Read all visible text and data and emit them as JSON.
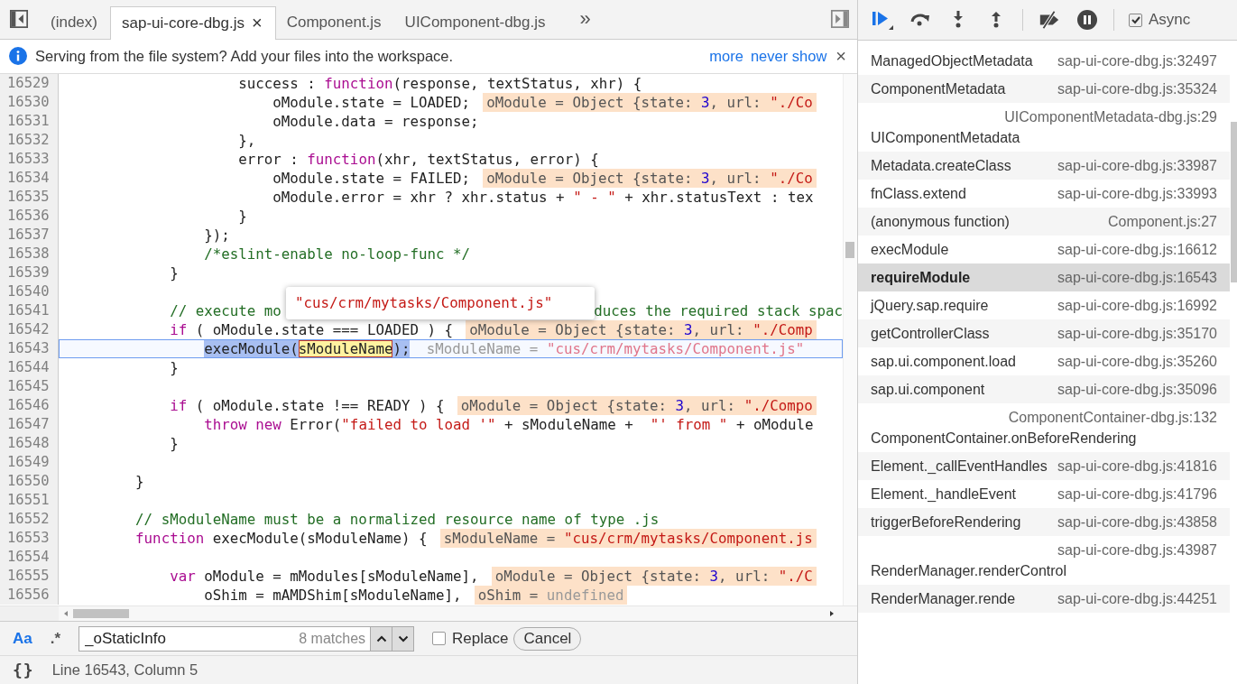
{
  "editor_tabs": {
    "tabs": [
      {
        "label": "(index)",
        "selected": false
      },
      {
        "label": "sap-ui-core-dbg.js",
        "selected": true,
        "close": "×"
      },
      {
        "label": "Component.js",
        "selected": false
      },
      {
        "label": "UIComponent-dbg.js",
        "selected": false
      }
    ],
    "more": "»"
  },
  "infobar": {
    "message": "Serving from the file system? Add your files into the workspace.",
    "links": [
      "more",
      "never show"
    ],
    "close": "×"
  },
  "code": {
    "popover": "\"cus/crm/mytasks/Component.js\"",
    "lines": [
      {
        "number": "16529",
        "current": false,
        "tokens": [
          {
            "kind": "plain",
            "text": "                    success : "
          },
          {
            "kind": "keyword",
            "text": "function"
          },
          {
            "kind": "plain",
            "text": "(response, textStatus, xhr) {"
          }
        ]
      },
      {
        "number": "16530",
        "current": false,
        "tokens": [
          {
            "kind": "plain",
            "text": "                        oModule.state = LOADED;"
          }
        ],
        "value": [
          {
            "kind": "name",
            "text": "oModule = Object {state: "
          },
          {
            "kind": "number",
            "text": "3"
          },
          {
            "kind": "name",
            "text": ", url: "
          },
          {
            "kind": "string",
            "text": "\"./Co"
          }
        ]
      },
      {
        "number": "16531",
        "current": false,
        "tokens": [
          {
            "kind": "plain",
            "text": "                        oModule.data = response;"
          }
        ]
      },
      {
        "number": "16532",
        "current": false,
        "tokens": [
          {
            "kind": "plain",
            "text": "                    },"
          }
        ]
      },
      {
        "number": "16533",
        "current": false,
        "tokens": [
          {
            "kind": "plain",
            "text": "                    error : "
          },
          {
            "kind": "keyword",
            "text": "function"
          },
          {
            "kind": "plain",
            "text": "(xhr, textStatus, error) {"
          }
        ]
      },
      {
        "number": "16534",
        "current": false,
        "tokens": [
          {
            "kind": "plain",
            "text": "                        oModule.state = FAILED;"
          }
        ],
        "value": [
          {
            "kind": "name",
            "text": "oModule = Object {state: "
          },
          {
            "kind": "number",
            "text": "3"
          },
          {
            "kind": "name",
            "text": ", url: "
          },
          {
            "kind": "string",
            "text": "\"./Co"
          }
        ]
      },
      {
        "number": "16535",
        "current": false,
        "tokens": [
          {
            "kind": "plain",
            "text": "                        oModule.error = xhr ? xhr.status + "
          },
          {
            "kind": "string",
            "text": "\" - \""
          },
          {
            "kind": "plain",
            "text": " + xhr.statusText : tex"
          }
        ]
      },
      {
        "number": "16536",
        "current": false,
        "tokens": [
          {
            "kind": "plain",
            "text": "                    }"
          }
        ]
      },
      {
        "number": "16537",
        "current": false,
        "tokens": [
          {
            "kind": "plain",
            "text": "                });"
          }
        ]
      },
      {
        "number": "16538",
        "current": false,
        "tokens": [
          {
            "kind": "comment",
            "text": "                /*eslint-enable no-loop-func */"
          }
        ]
      },
      {
        "number": "16539",
        "current": false,
        "tokens": [
          {
            "kind": "plain",
            "text": "            }"
          }
        ]
      },
      {
        "number": "16540",
        "current": false
      },
      {
        "number": "16541",
        "current": false,
        "tokens": [
          {
            "kind": "comment",
            "text": "            // execute mo"
          },
          {
            "kind": "gap"
          },
          {
            "kind": "comment",
            "text": "duces the required stack spac"
          }
        ]
      },
      {
        "number": "16542",
        "current": false,
        "tokens": [
          {
            "kind": "keyword",
            "text": "            if"
          },
          {
            "kind": "plain",
            "text": " ( oModule.state === LOADED ) {"
          }
        ],
        "value": [
          {
            "kind": "name",
            "text": "oModule = Object {state: "
          },
          {
            "kind": "number",
            "text": "3"
          },
          {
            "kind": "name",
            "text": ", url: "
          },
          {
            "kind": "string",
            "text": "\"./Comp"
          }
        ]
      },
      {
        "number": "16543",
        "current": true,
        "tokens": [
          {
            "kind": "selection",
            "text": "                execModule("
          },
          {
            "kind": "match",
            "text": "sModuleName"
          },
          {
            "kind": "selection",
            "text": ");"
          }
        ],
        "value": [
          {
            "kind": "name",
            "text": "sModuleName = "
          },
          {
            "kind": "string",
            "text": "\"cus/crm/mytasks/Component.js\""
          }
        ]
      },
      {
        "number": "16544",
        "current": false,
        "tokens": [
          {
            "kind": "plain",
            "text": "            }"
          }
        ]
      },
      {
        "number": "16545",
        "current": false
      },
      {
        "number": "16546",
        "current": false,
        "tokens": [
          {
            "kind": "keyword",
            "text": "            if"
          },
          {
            "kind": "plain",
            "text": " ( oModule.state !== READY ) {"
          }
        ],
        "value": [
          {
            "kind": "name",
            "text": "oModule = Object {state: "
          },
          {
            "kind": "number",
            "text": "3"
          },
          {
            "kind": "name",
            "text": ", url: "
          },
          {
            "kind": "string",
            "text": "\"./Compo"
          }
        ]
      },
      {
        "number": "16547",
        "current": false,
        "tokens": [
          {
            "kind": "keyword",
            "text": "                throw new"
          },
          {
            "kind": "plain",
            "text": " Error("
          },
          {
            "kind": "string",
            "text": "\"failed to load '\""
          },
          {
            "kind": "plain",
            "text": " + sModuleName +  "
          },
          {
            "kind": "string",
            "text": "\"' from \""
          },
          {
            "kind": "plain",
            "text": " + oModule"
          }
        ]
      },
      {
        "number": "16548",
        "current": false,
        "tokens": [
          {
            "kind": "plain",
            "text": "            }"
          }
        ]
      },
      {
        "number": "16549",
        "current": false
      },
      {
        "number": "16550",
        "current": false,
        "tokens": [
          {
            "kind": "plain",
            "text": "        }"
          }
        ]
      },
      {
        "number": "16551",
        "current": false
      },
      {
        "number": "16552",
        "current": false,
        "tokens": [
          {
            "kind": "comment",
            "text": "        // sModuleName must be a normalized resource name of type .js"
          }
        ]
      },
      {
        "number": "16553",
        "current": false,
        "tokens": [
          {
            "kind": "keyword",
            "text": "        function"
          },
          {
            "kind": "plain",
            "text": " execModule(sModuleName) {"
          }
        ],
        "value": [
          {
            "kind": "name",
            "text": "sModuleName = "
          },
          {
            "kind": "string",
            "text": "\"cus/crm/mytasks/Component.js"
          }
        ]
      },
      {
        "number": "16554",
        "current": false
      },
      {
        "number": "16555",
        "current": false,
        "tokens": [
          {
            "kind": "keyword",
            "text": "            var"
          },
          {
            "kind": "plain",
            "text": " oModule = mModules[sModuleName],"
          }
        ],
        "value": [
          {
            "kind": "name",
            "text": "oModule = Object {state: "
          },
          {
            "kind": "number",
            "text": "3"
          },
          {
            "kind": "name",
            "text": ", url: "
          },
          {
            "kind": "string",
            "text": "\"./C"
          }
        ]
      },
      {
        "number": "16556",
        "current": false,
        "tokens": [
          {
            "kind": "plain",
            "text": "                oShim = mAMDShim[sModuleName],"
          }
        ],
        "value": [
          {
            "kind": "name",
            "text": "oShim = "
          },
          {
            "kind": "undefined",
            "text": "undefined"
          }
        ]
      }
    ]
  },
  "search": {
    "toggles": [
      {
        "label": "Aa",
        "selected": true
      },
      {
        "label": ".*",
        "selected": false
      }
    ],
    "value": "_oStaticInfo",
    "matches": "8 matches",
    "replace": {
      "label": "Replace",
      "checked": false
    },
    "cancel": "Cancel"
  },
  "status_bar": {
    "format": "{}",
    "position": "Line 16543, Column 5"
  },
  "debugger": {
    "async": {
      "label": "Async",
      "checked": true
    },
    "call_stack": [
      {
        "name": "ManagedObjectMetadata",
        "location": "sap-ui-core-dbg.js:32497",
        "kind": "inline",
        "selected": false
      },
      {
        "name": "ComponentMetadata",
        "location": "sap-ui-core-dbg.js:35324",
        "kind": "inline",
        "selected": false
      },
      {
        "name": "UIComponentMetadata",
        "location": "UIComponentMetadata-dbg.js:29",
        "kind": "stacked",
        "selected": false
      },
      {
        "name": "Metadata.createClass",
        "location": "sap-ui-core-dbg.js:33987",
        "kind": "inline",
        "selected": false
      },
      {
        "name": "fnClass.extend",
        "location": "sap-ui-core-dbg.js:33993",
        "kind": "inline",
        "selected": false
      },
      {
        "name": "(anonymous function)",
        "location": "Component.js:27",
        "kind": "inline",
        "selected": false
      },
      {
        "name": "execModule",
        "location": "sap-ui-core-dbg.js:16612",
        "kind": "inline",
        "selected": false
      },
      {
        "name": "requireModule",
        "location": "sap-ui-core-dbg.js:16543",
        "kind": "inline",
        "selected": true
      },
      {
        "name": "jQuery.sap.require",
        "location": "sap-ui-core-dbg.js:16992",
        "kind": "inline",
        "selected": false
      },
      {
        "name": "getControllerClass",
        "location": "sap-ui-core-dbg.js:35170",
        "kind": "inline",
        "selected": false
      },
      {
        "name": "sap.ui.component.load",
        "location": "sap-ui-core-dbg.js:35260",
        "kind": "inline",
        "selected": false
      },
      {
        "name": "sap.ui.component",
        "location": "sap-ui-core-dbg.js:35096",
        "kind": "inline",
        "selected": false
      },
      {
        "name": "ComponentContainer.onBeforeRendering",
        "location": "ComponentContainer-dbg.js:132",
        "kind": "stacked",
        "selected": false
      },
      {
        "name": "Element._callEventHandles",
        "location": "sap-ui-core-dbg.js:41816",
        "kind": "inline",
        "selected": false
      },
      {
        "name": "Element._handleEvent",
        "location": "sap-ui-core-dbg.js:41796",
        "kind": "inline",
        "selected": false
      },
      {
        "name": "triggerBeforeRendering",
        "location": "sap-ui-core-dbg.js:43858",
        "kind": "inline",
        "selected": false
      },
      {
        "name": "RenderManager.renderControl",
        "location": "sap-ui-core-dbg.js:43987",
        "kind": "stacked",
        "selected": false
      },
      {
        "name": "RenderManager.rende",
        "location": "sap-ui-core-dbg.js:44251",
        "kind": "inline",
        "selected": false
      }
    ]
  }
}
